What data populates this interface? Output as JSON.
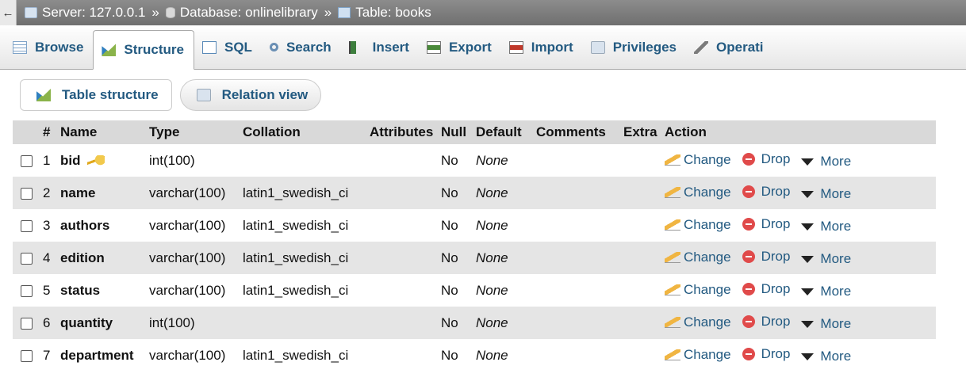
{
  "breadcrumb": {
    "server": "Server: 127.0.0.1",
    "database": "Database: onlinelibrary",
    "table": "Table: books",
    "separator": "»"
  },
  "tabs": [
    {
      "label": "Browse",
      "icon": "browse-icon"
    },
    {
      "label": "Structure",
      "icon": "structure-icon",
      "active": true
    },
    {
      "label": "SQL",
      "icon": "sql-icon"
    },
    {
      "label": "Search",
      "icon": "search-icon"
    },
    {
      "label": "Insert",
      "icon": "insert-icon"
    },
    {
      "label": "Export",
      "icon": "export-icon"
    },
    {
      "label": "Import",
      "icon": "import-icon"
    },
    {
      "label": "Privileges",
      "icon": "privileges-icon"
    },
    {
      "label": "Operati",
      "icon": "operations-icon"
    }
  ],
  "subtabs": [
    {
      "label": "Table structure",
      "icon": "structure-icon",
      "active": true
    },
    {
      "label": "Relation view",
      "icon": "relation-icon"
    }
  ],
  "columns": [
    "#",
    "Name",
    "Type",
    "Collation",
    "Attributes",
    "Null",
    "Default",
    "Comments",
    "Extra",
    "Action"
  ],
  "rows": [
    {
      "num": "1",
      "name": "bid",
      "type": "int(100)",
      "collation": "",
      "null": "No",
      "default": "None",
      "primary_key": true
    },
    {
      "num": "2",
      "name": "name",
      "type": "varchar(100)",
      "collation": "latin1_swedish_ci",
      "null": "No",
      "default": "None"
    },
    {
      "num": "3",
      "name": "authors",
      "type": "varchar(100)",
      "collation": "latin1_swedish_ci",
      "null": "No",
      "default": "None"
    },
    {
      "num": "4",
      "name": "edition",
      "type": "varchar(100)",
      "collation": "latin1_swedish_ci",
      "null": "No",
      "default": "None"
    },
    {
      "num": "5",
      "name": "status",
      "type": "varchar(100)",
      "collation": "latin1_swedish_ci",
      "null": "No",
      "default": "None"
    },
    {
      "num": "6",
      "name": "quantity",
      "type": "int(100)",
      "collation": "",
      "null": "No",
      "default": "None"
    },
    {
      "num": "7",
      "name": "department",
      "type": "varchar(100)",
      "collation": "latin1_swedish_ci",
      "null": "No",
      "default": "None"
    }
  ],
  "actions": {
    "change": "Change",
    "drop": "Drop",
    "more": "More"
  },
  "colors": {
    "link": "#235a81",
    "row_alt": "#e5e5e5",
    "header_bg": "#d9d9d9",
    "drop": "#e04a4a"
  }
}
